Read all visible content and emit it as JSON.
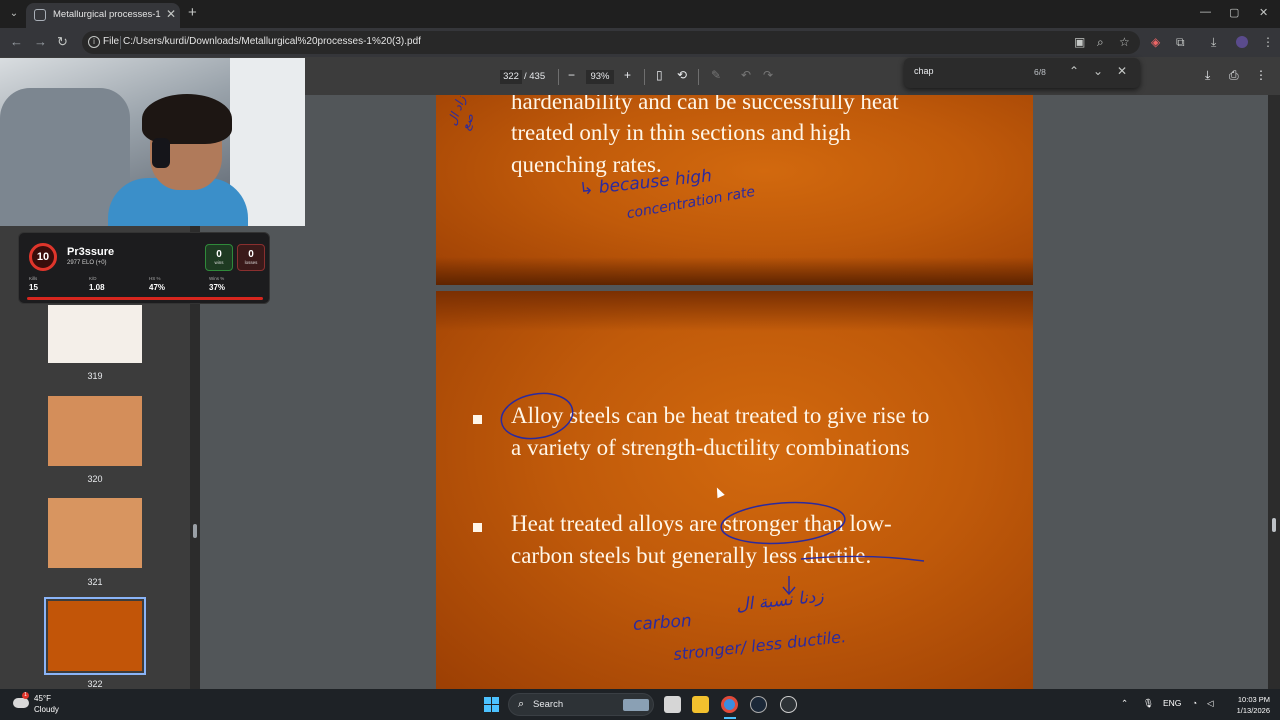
{
  "browser": {
    "tab_title": "Metallurgical processes-1 (3).pdf",
    "file_label": "File",
    "url": "C:/Users/kurdi/Downloads/Metallurgical%20processes-1%20(3).pdf"
  },
  "pdf": {
    "current_page": "322",
    "total_pages": "/ 435",
    "zoom": "93%"
  },
  "find": {
    "query": "chap",
    "count": "6/8"
  },
  "thumbnails": [
    {
      "num": "319"
    },
    {
      "num": "320"
    },
    {
      "num": "321"
    },
    {
      "num": "322"
    }
  ],
  "overlay": {
    "level": "10",
    "name": "Pr3ssure",
    "elo": "2977 ELO (+0)",
    "wins": "0",
    "wins_label": "wins",
    "losses": "0",
    "losses_label": "losses",
    "stats": [
      {
        "label": "Kills",
        "value": "15"
      },
      {
        "label": "K/D",
        "value": "1.08"
      },
      {
        "label": "HS %",
        "value": "47%"
      },
      {
        "label": "Wins %",
        "value": "37%"
      }
    ]
  },
  "slide1": {
    "line1": "hardenability and can be successfully heat",
    "line2": "treated only in thin sections and high",
    "line3": "quenching rates.",
    "note1": "↳ because  high",
    "note2": "concentration  rate",
    "note_ar": "زاد ال\nصع"
  },
  "slide2": {
    "b1_line1": "Alloy steels can be heat treated to give rise to",
    "b1_line2": "a variety of strength-ductility combinations",
    "b2_line1": "Heat treated alloys are stronger than low-",
    "b2_line2": "carbon steels but generally less ductile.",
    "note_ar": "زدنا نسبة ال",
    "note_carbon": "carbon",
    "note3": "stronger/ less ductile."
  },
  "taskbar": {
    "temp": "45°F",
    "weather": "Cloudy",
    "search": "Search",
    "lang": "ENG",
    "time": "10:03 PM",
    "date": "1/13/2026"
  }
}
